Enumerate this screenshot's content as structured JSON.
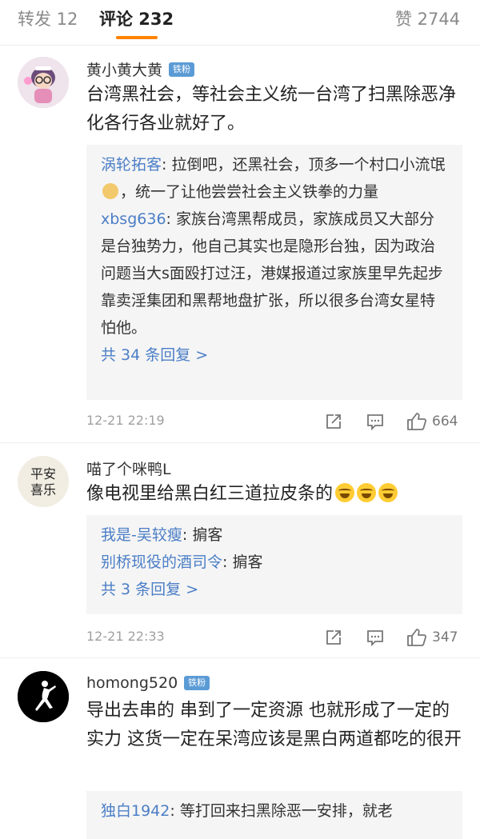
{
  "tabs": {
    "repost": "转发 12",
    "comments": "评论 232",
    "likes": "赞 2744"
  },
  "comments": [
    {
      "user": "黄小黄大黄",
      "badge": "铁粉",
      "text": "台湾黑社会，等社会主义统一台湾了扫黑除恶净化各行各业就好了。",
      "replies": [
        {
          "user": "涡轮拓客",
          "text": "拉倒吧，还黑社会，顶多一个村口小流氓",
          "text_after": "，统一了让他尝尝社会主义铁拳的力量"
        },
        {
          "user": "xbsg636",
          "text": "家族台湾黑帮成员，家族成员又大部分是台独势力，他自己其实也是隐形台独，因为政治问题当大s面殴打过汪，港媒报道过家族里早先起步靠卖淫集团和黑帮地盘扩张，所以很多台湾女星特怕他。"
        }
      ],
      "more_replies": "共 34 条回复 >",
      "time": "12-21 22:19",
      "like_count": "664"
    },
    {
      "user": "喵了个咪鸭L",
      "text": "像电视里给黑白红三道拉皮条的",
      "emoji_count": 3,
      "replies": [
        {
          "user": "我是-吴较瘦",
          "text": "掮客"
        },
        {
          "user": "别桥现役的酒司令",
          "text": "掮客"
        }
      ],
      "more_replies": "共 3 条回复 >",
      "time": "12-21 22:33",
      "like_count": "347"
    },
    {
      "user": "homong520",
      "badge": "铁粉",
      "text": "导出去串的  串到了一定资源  也就形成了一定的实力  这货一定在呆湾应该是黑白两道都吃的很开",
      "replies": [
        {
          "user": "独白1942",
          "text": "等打回来扫黑除恶一安排，就老"
        }
      ]
    }
  ],
  "colors": {
    "accent": "#ff8200",
    "link": "#4b7ec6",
    "badge": "#5b9bd5"
  },
  "icons": [
    "repost-icon",
    "comment-icon",
    "like-icon"
  ]
}
